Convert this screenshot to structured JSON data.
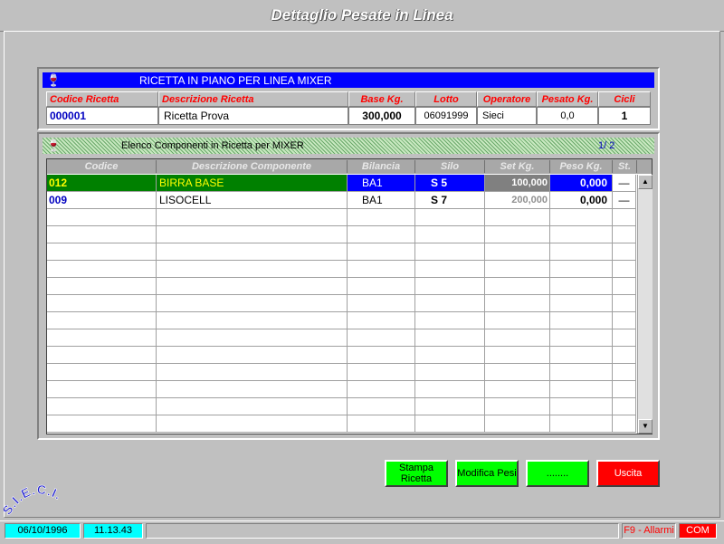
{
  "app_title": "Dettaglio Pesate  in  Linea",
  "recipe_panel": {
    "title": "RICETTA IN PIANO PER LINEA MIXER",
    "headers": [
      "Codice Ricetta",
      "Descrizione Ricetta",
      "Base Kg.",
      "Lotto",
      "Operatore",
      "Pesato Kg.",
      "Cicli"
    ],
    "row": [
      "000001",
      "Ricetta Prova",
      "300,000",
      "06091999",
      "Sieci",
      "0,0",
      "1"
    ]
  },
  "components_panel": {
    "title": "Elenco Componenti in Ricetta per MIXER",
    "page": "1/ 2",
    "headers": [
      "Codice",
      "Descrizione  Componente",
      "Bilancia",
      "Silo",
      "Set  Kg.",
      "Peso Kg.",
      "St."
    ],
    "rows": [
      [
        "012",
        "BIRRA BASE",
        "BA1",
        "S 5",
        "100,000",
        "0,000",
        "—"
      ],
      [
        "009",
        "LISOCELL",
        "BA1",
        "S 7",
        "200,000",
        "0,000",
        "—"
      ]
    ],
    "empty_rows": 13
  },
  "buttons": {
    "stampa_line1": "Stampa",
    "stampa_line2": "Ricetta",
    "modifica": "Modifica Pesi",
    "blank": "........",
    "uscita": "Uscita"
  },
  "logo_text": "S.I.E.C.I.",
  "status": {
    "date": "06/10/1996",
    "time": "11.13.43",
    "alarms": "F9 - Allarmi",
    "com": "COM"
  },
  "colors": {
    "header_blue": "#0000ff",
    "selected_green": "#008000",
    "button_green": "#00ff00",
    "button_red": "#ff0000"
  }
}
